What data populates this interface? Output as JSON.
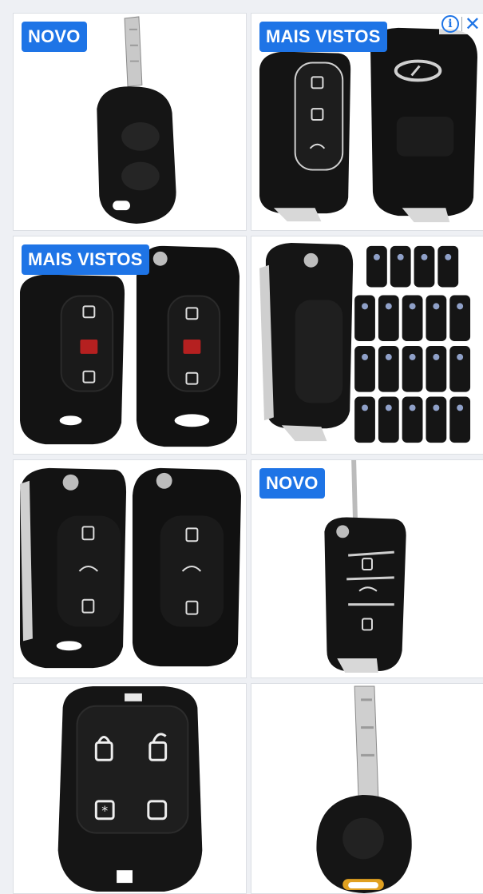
{
  "ad": {
    "adchoices_icon": "info-icon",
    "close_icon": "close-icon",
    "accent_color": "#1e74e6"
  },
  "products": [
    {
      "badge": "NOVO",
      "type": "remote-key-2-button"
    },
    {
      "badge": "MAIS VISTOS",
      "type": "hyundai-flip-key-3-button"
    },
    {
      "badge": "MAIS VISTOS",
      "type": "kia-flip-key-3-button-panic"
    },
    {
      "badge": "",
      "type": "flip-key-bulk-pack"
    },
    {
      "badge": "",
      "type": "flip-key-3-button-trunk"
    },
    {
      "badge": "NOVO",
      "type": "peugeot-flip-key-3-button"
    },
    {
      "badge": "",
      "type": "alarm-remote-4-button"
    },
    {
      "badge": "",
      "type": "transponder-key-blade"
    }
  ]
}
